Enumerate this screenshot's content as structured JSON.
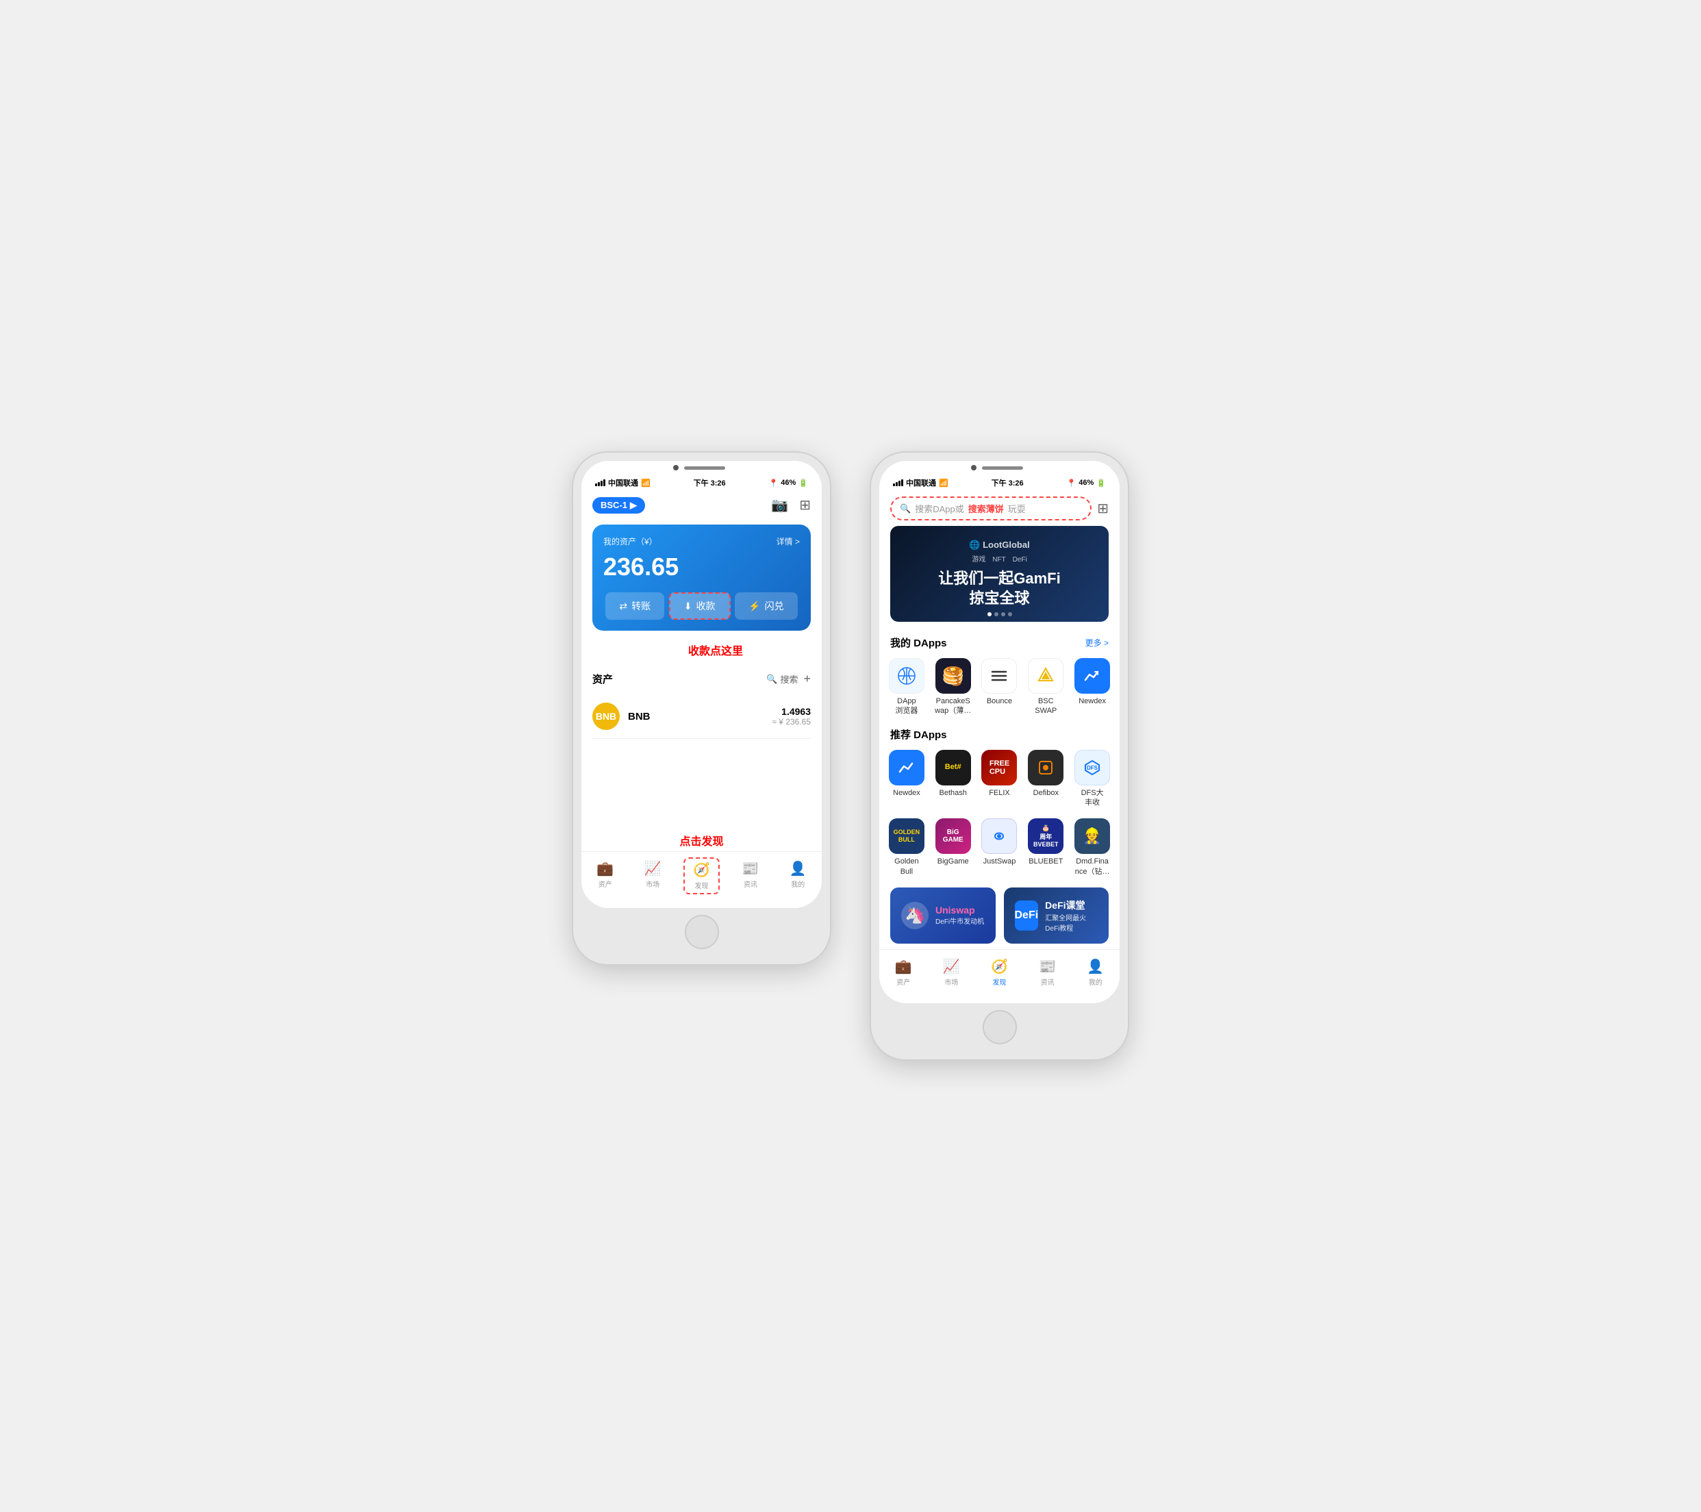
{
  "left_phone": {
    "status": {
      "carrier": "中国联通",
      "time": "下午 3:26",
      "battery": "46%"
    },
    "header": {
      "network": "BSC-1"
    },
    "balance_card": {
      "label": "我的资产（¥）",
      "detail": "详情 >",
      "amount": "236.65",
      "actions": {
        "transfer": "转账",
        "receive": "收款",
        "flash": "闪兑"
      }
    },
    "annotation_receive": "收款点这里",
    "assets_section": {
      "title": "资产",
      "search": "搜索",
      "items": [
        {
          "name": "BNB",
          "amount": "1.4963",
          "cny": "≈ ¥ 236.65"
        }
      ]
    },
    "annotation_discover": "点击发现",
    "nav": {
      "items": [
        {
          "label": "资产",
          "active": false
        },
        {
          "label": "市场",
          "active": false
        },
        {
          "label": "发现",
          "active": false,
          "highlighted": true
        },
        {
          "label": "资讯",
          "active": false
        },
        {
          "label": "我的",
          "active": false
        }
      ]
    }
  },
  "right_phone": {
    "status": {
      "carrier": "中国联通",
      "time": "下午 3:26",
      "battery": "46%"
    },
    "search": {
      "placeholder": "搜索DApp或",
      "highlight": "搜索薄饼",
      "placeholder2": "玩耍"
    },
    "banner": {
      "logo": "LootGlobal",
      "subtitle": "游戏  NFT  DeFi",
      "title": "让我们一起GamFi\n掠宝全球"
    },
    "my_dapps": {
      "title": "我的 DApps",
      "more": "更多 >",
      "items": [
        {
          "name": "DApp\n浏览器",
          "icon": "🧭",
          "color": "#f5f5f5"
        },
        {
          "name": "PancakeS\nwap（薄…",
          "icon": "🥞",
          "color": "#1a1a2e"
        },
        {
          "name": "Bounce",
          "icon": "≋",
          "color": "#fff"
        },
        {
          "name": "BSC\nSWAP",
          "icon": "◈",
          "color": "#fff"
        },
        {
          "name": "Newdex",
          "icon": "✓",
          "color": "#4a90d9"
        }
      ]
    },
    "recommended_dapps": {
      "title": "推荐 DApps",
      "row1": [
        {
          "name": "Newdex",
          "color": "#1a7aff"
        },
        {
          "name": "Bethash",
          "color": "#1a1a1a"
        },
        {
          "name": "FELIX",
          "color": "#8b1a1a"
        },
        {
          "name": "Defibox",
          "color": "#2a2a2a"
        },
        {
          "name": "DFS大\n丰收",
          "color": "#e8f4ff"
        }
      ],
      "row2": [
        {
          "name": "Golden\nBull",
          "color": "#1a3a6e"
        },
        {
          "name": "BigGame",
          "color": "#8b1a6e"
        },
        {
          "name": "JustSwap",
          "color": "#e8f0ff"
        },
        {
          "name": "BLUEBET",
          "color": "#1a2a6e"
        },
        {
          "name": "Dmd.Fina\nnce（钻…",
          "color": "#2a4a6e"
        }
      ]
    },
    "promos": [
      {
        "title": "Uniswap",
        "subtitle": "DeFi牛市发动机",
        "bg": "blue"
      },
      {
        "title": "DeFi课堂",
        "subtitle": "汇聚全网最火DeFi教程",
        "bg": "darkblue"
      }
    ],
    "nav": {
      "items": [
        {
          "label": "资产",
          "active": false
        },
        {
          "label": "市场",
          "active": false
        },
        {
          "label": "发现",
          "active": true
        },
        {
          "label": "资讯",
          "active": false
        },
        {
          "label": "我的",
          "active": false
        }
      ]
    }
  }
}
